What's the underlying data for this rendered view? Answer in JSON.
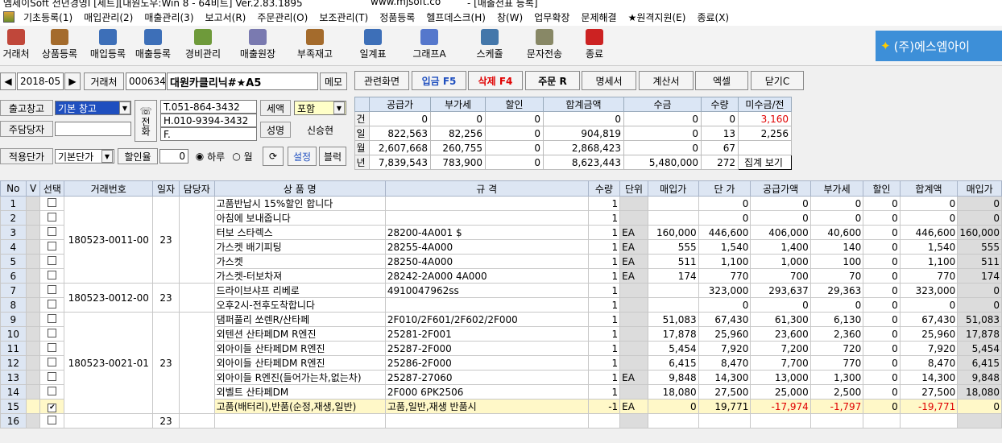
{
  "title": {
    "text": "엠세이Soft 전년경영I [세트][내원노우:Win 8 - 64비트] Ver.2.83.1895",
    "url": "www.mjsoft.co",
    "form": "- [매출전표 등록]"
  },
  "menu": [
    "기초등록(1)",
    "매입관리(2)",
    "매출관리(3)",
    "보고서(R)",
    "주문관리(O)",
    "보조관리(T)",
    "정품등록",
    "헬프데스크(H)",
    "창(W)",
    "업무확장",
    "문제해결",
    "★원격지원(E)",
    "종료(X)"
  ],
  "toolbar": [
    {
      "label": "거래처",
      "color": "#c0473a"
    },
    {
      "label": "상품등록",
      "color": "#a46b2c"
    },
    {
      "label": "매입등록",
      "color": "#3d6fb8"
    },
    {
      "label": "매출등록",
      "color": "#3d6fb8"
    },
    {
      "label": "경비관리",
      "color": "#6e9a3a"
    },
    {
      "label": "매출원장",
      "color": "#7a7ab0"
    },
    {
      "label": "부족재고",
      "color": "#a46b2c"
    },
    {
      "label": "일계표",
      "color": "#3d6fb8"
    },
    {
      "label": "그래프A",
      "color": "#5577cc"
    },
    {
      "label": "스케쥴",
      "color": "#4477aa"
    },
    {
      "label": "문자전송",
      "color": "#888866"
    },
    {
      "label": "종료",
      "color": "#cc2222"
    }
  ],
  "logo": "(주)에스엠아이",
  "header": {
    "date": "2018-05",
    "client_label": "거래처",
    "client_code": "000634",
    "client_name": "대원카클리닉#★A5",
    "memo": "메모",
    "outbound_label": "출고창고",
    "outbound_value": "기본 창고",
    "manager_label": "주담당자",
    "phone_label": "전화",
    "tel": "T.051-864-3432",
    "hp": "H.010-9394-3432",
    "fax": "F.",
    "tax_label": "세액",
    "tax_value": "포함",
    "name_label": "성명",
    "name_value": "신승현",
    "price_label": "적용단가",
    "price_value": "기본단가",
    "discount_label": "할인율",
    "discount_value": "0",
    "day_label": "하루",
    "month_label": "월",
    "setting": "설정",
    "block": "블럭"
  },
  "actions": [
    "관련화면",
    "입금 F5",
    "삭제 F4",
    "주문 R",
    "명세서",
    "계산서",
    "엑셀",
    "닫기C"
  ],
  "summary": {
    "headers": [
      "",
      "공급가",
      "부가세",
      "할인",
      "합계금액",
      "수금",
      "수량",
      "미수금/전"
    ],
    "rows": [
      [
        "건",
        "0",
        "0",
        "0",
        "0",
        "0",
        "0",
        "3,160"
      ],
      [
        "일",
        "822,563",
        "82,256",
        "0",
        "904,819",
        "0",
        "13",
        "2,256"
      ],
      [
        "월",
        "2,607,668",
        "260,755",
        "0",
        "2,868,423",
        "0",
        "67",
        ""
      ],
      [
        "년",
        "7,839,543",
        "783,900",
        "0",
        "8,623,443",
        "5,480,000",
        "272",
        "집계 보기"
      ]
    ]
  },
  "grid": {
    "headers": [
      "No",
      "V",
      "선택",
      "거래번호",
      "일자",
      "담당자",
      "상 품 명",
      "규 격",
      "수량",
      "단위",
      "매입가",
      "단 가",
      "공급가액",
      "부가세",
      "할인",
      "합계액",
      "매입가"
    ],
    "groups": [
      {
        "trade": "180523-0011-00",
        "day": "23",
        "rows": [
          1,
          2,
          3,
          4,
          5,
          6
        ]
      },
      {
        "trade": "180523-0012-00",
        "day": "23",
        "rows": [
          7,
          8
        ]
      },
      {
        "trade": "180523-0021-01",
        "day": "23",
        "rows": [
          9,
          10,
          11,
          12,
          13,
          14,
          15
        ]
      },
      {
        "trade": "",
        "day": "23",
        "rows": [
          16
        ]
      }
    ],
    "rows": [
      {
        "no": "1",
        "name": "고품반납시 15%할인 합니다",
        "spec": "",
        "qty": "1",
        "unit": "",
        "cost": "",
        "price": "0",
        "supply": "0",
        "vat": "0",
        "disc": "0",
        "total": "0",
        "cost2": "0"
      },
      {
        "no": "2",
        "name": "아침에 보내줍니다",
        "spec": "",
        "qty": "1",
        "unit": "",
        "cost": "",
        "price": "0",
        "supply": "0",
        "vat": "0",
        "disc": "0",
        "total": "0",
        "cost2": "0"
      },
      {
        "no": "3",
        "name": "터보 스타렉스",
        "spec": "28200-4A001 $",
        "qty": "1",
        "unit": "EA",
        "cost": "160,000",
        "price": "446,600",
        "supply": "406,000",
        "vat": "40,600",
        "disc": "0",
        "total": "446,600",
        "cost2": "160,000"
      },
      {
        "no": "4",
        "name": "가스켓 배기피팅",
        "spec": "28255-4A000",
        "qty": "1",
        "unit": "EA",
        "cost": "555",
        "price": "1,540",
        "supply": "1,400",
        "vat": "140",
        "disc": "0",
        "total": "1,540",
        "cost2": "555"
      },
      {
        "no": "5",
        "name": "가스켓",
        "spec": "28250-4A000",
        "qty": "1",
        "unit": "EA",
        "cost": "511",
        "price": "1,100",
        "supply": "1,000",
        "vat": "100",
        "disc": "0",
        "total": "1,100",
        "cost2": "511"
      },
      {
        "no": "6",
        "name": "가스켓-터보차져",
        "spec": "28242-2A000 4A000",
        "qty": "1",
        "unit": "EA",
        "cost": "174",
        "price": "770",
        "supply": "700",
        "vat": "70",
        "disc": "0",
        "total": "770",
        "cost2": "174"
      },
      {
        "no": "7",
        "name": "드라이브샤프 리베로",
        "spec": "4910047962ss",
        "qty": "1",
        "unit": "",
        "cost": "",
        "price": "323,000",
        "supply": "293,637",
        "vat": "29,363",
        "disc": "0",
        "total": "323,000",
        "cost2": "0"
      },
      {
        "no": "8",
        "name": "오후2시-전후도착합니다",
        "spec": "",
        "qty": "1",
        "unit": "",
        "cost": "",
        "price": "0",
        "supply": "0",
        "vat": "0",
        "disc": "0",
        "total": "0",
        "cost2": "0"
      },
      {
        "no": "9",
        "name": "댐퍼풀리 쏘렌R/산타페",
        "spec": "2F010/2F601/2F602/2F000",
        "qty": "1",
        "unit": "",
        "cost": "51,083",
        "price": "67,430",
        "supply": "61,300",
        "vat": "6,130",
        "disc": "0",
        "total": "67,430",
        "cost2": "51,083"
      },
      {
        "no": "10",
        "name": "외텐션 산타페DM R엔진",
        "spec": "25281-2F001",
        "qty": "1",
        "unit": "",
        "cost": "17,878",
        "price": "25,960",
        "supply": "23,600",
        "vat": "2,360",
        "disc": "0",
        "total": "25,960",
        "cost2": "17,878"
      },
      {
        "no": "11",
        "name": "외아이들 산타페DM R엔진",
        "spec": "25287-2F000",
        "qty": "1",
        "unit": "",
        "cost": "5,454",
        "price": "7,920",
        "supply": "7,200",
        "vat": "720",
        "disc": "0",
        "total": "7,920",
        "cost2": "5,454"
      },
      {
        "no": "12",
        "name": "외아이들 산타페DM R엔진",
        "spec": "25286-2F000",
        "qty": "1",
        "unit": "",
        "cost": "6,415",
        "price": "8,470",
        "supply": "7,700",
        "vat": "770",
        "disc": "0",
        "total": "8,470",
        "cost2": "6,415"
      },
      {
        "no": "13",
        "name": "외아이들 R엔진(들어가는차,없는차)",
        "spec": "25287-27060",
        "qty": "1",
        "unit": "EA",
        "cost": "9,848",
        "price": "14,300",
        "supply": "13,000",
        "vat": "1,300",
        "disc": "0",
        "total": "14,300",
        "cost2": "9,848"
      },
      {
        "no": "14",
        "name": "외벨트 산타페DM",
        "spec": "2F000 6PK2506",
        "qty": "1",
        "unit": "",
        "cost": "18,080",
        "price": "27,500",
        "supply": "25,000",
        "vat": "2,500",
        "disc": "0",
        "total": "27,500",
        "cost2": "18,080"
      },
      {
        "no": "15",
        "name": "고품(배터리),반품(순정,재생,일반)",
        "spec": "고품,일반,재생 반품시",
        "qty": "-1",
        "unit": "EA",
        "cost": "0",
        "price": "19,771",
        "supply": "-17,974",
        "vat": "-1,797",
        "disc": "0",
        "total": "-19,771",
        "cost2": "0",
        "checked": true
      },
      {
        "no": "16",
        "name": "",
        "spec": "",
        "qty": "",
        "unit": "",
        "cost": "",
        "price": "",
        "supply": "",
        "vat": "",
        "disc": "",
        "total": "",
        "cost2": ""
      }
    ]
  }
}
